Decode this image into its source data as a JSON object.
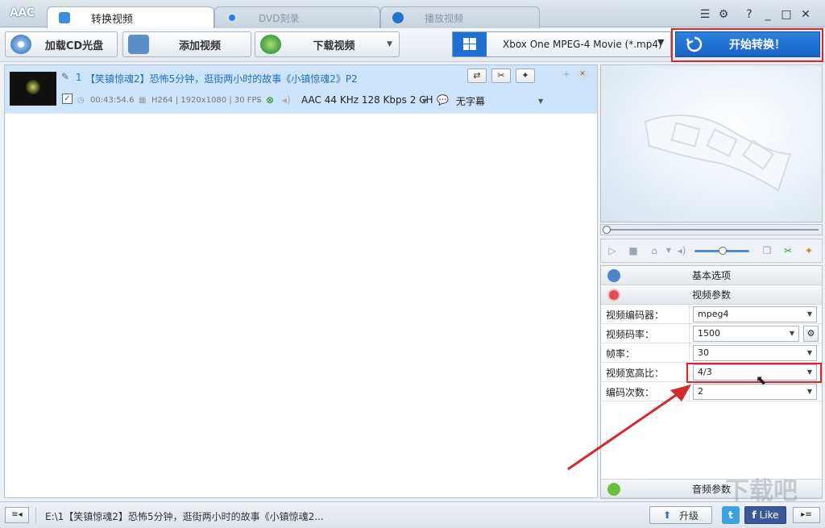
{
  "app": {
    "logo": "AAC"
  },
  "tabs": [
    {
      "label": "转换视频",
      "state": "active"
    },
    {
      "label": "DVD刻录",
      "state": "inactive"
    },
    {
      "label": "播放视频",
      "state": "inactive"
    }
  ],
  "window_buttons": {
    "menu": "☰",
    "settings": "⚙",
    "help": "?",
    "minimize": "_",
    "maximize": "□",
    "close": "✕"
  },
  "toolbar": {
    "load_cd": "加载CD光盘",
    "add_video": "添加视频",
    "download_video": "下载视频",
    "profile": "Xbox One MPEG-4 Movie (*.mp4)",
    "start": "开始转换！"
  },
  "file": {
    "index": "1",
    "title": "【笑镇惊魂2】恐怖5分钟，逛街两小时的故事《小镇惊魂2》P2",
    "duration": "00:43:54.6",
    "video_info": "H264 | 1920x1080 | 30 FPS",
    "audio_info": "AAC 44 KHz 128 Kbps 2 CH",
    "subtitle": "无字幕"
  },
  "options": {
    "basic": "基本选项",
    "video_params": "视频参数",
    "audio_params": "音频参数",
    "rows": [
      {
        "label": "视频编码器：",
        "value": "mpeg4"
      },
      {
        "label": "视频码率：",
        "value": "1500"
      },
      {
        "label": "帧率：",
        "value": "30"
      },
      {
        "label": "视频宽高比：",
        "value": "4/3"
      },
      {
        "label": "编码次数：",
        "value": "2"
      }
    ]
  },
  "status": {
    "path": "E:\\1【笑镇惊魂2】恐怖5分钟，逛街两小时的故事《小镇惊魂2...",
    "upgrade": "升级",
    "like": "Like"
  },
  "colors": {
    "accent": "#1a63c4",
    "highlight": "#e0242c",
    "selection": "#cde4fb"
  },
  "watermark": "下载吧"
}
